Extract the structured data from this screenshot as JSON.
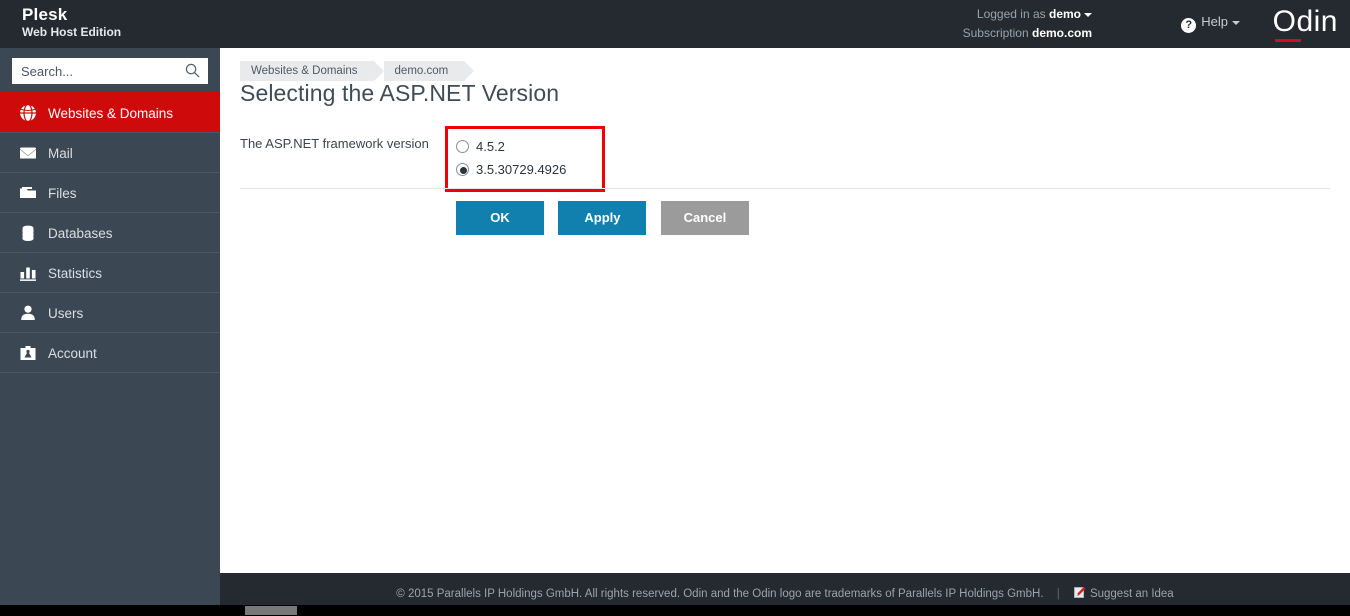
{
  "header": {
    "brand_name": "Plesk",
    "brand_sub": "Web Host Edition",
    "logged_in_label": "Logged in as",
    "logged_in_user": "demo",
    "subscription_label": "Subscription",
    "subscription_value": "demo.com",
    "help_label": "Help",
    "help_icon": "question-circle-icon",
    "logo_text": "Odin",
    "accent_red": "#cf0a2c",
    "bg": "#242a30"
  },
  "sidebar": {
    "search": {
      "placeholder": "Search...",
      "value": "",
      "icon": "search-icon"
    },
    "active_index": 0,
    "active_color": "#cf0a0a",
    "bg": "#3b4854",
    "items": [
      {
        "label": "Websites & Domains",
        "icon": "globe-icon"
      },
      {
        "label": "Mail",
        "icon": "envelope-icon"
      },
      {
        "label": "Files",
        "icon": "folder-icon"
      },
      {
        "label": "Databases",
        "icon": "database-icon"
      },
      {
        "label": "Statistics",
        "icon": "bar-chart-icon"
      },
      {
        "label": "Users",
        "icon": "user-icon"
      },
      {
        "label": "Account",
        "icon": "briefcase-icon"
      }
    ]
  },
  "main": {
    "breadcrumb": [
      {
        "label": "Websites & Domains"
      },
      {
        "label": "demo.com"
      }
    ],
    "title": "Selecting the ASP.NET Version",
    "form": {
      "label": "The ASP.NET framework version",
      "highlight_color": "#f10000",
      "options": [
        {
          "label": "4.5.2",
          "selected": false
        },
        {
          "label": "3.5.30729.4926",
          "selected": true
        }
      ]
    },
    "buttons": [
      {
        "label": "OK",
        "style": "primary"
      },
      {
        "label": "Apply",
        "style": "primary"
      },
      {
        "label": "Cancel",
        "style": "neutral"
      }
    ],
    "button_blue": "#1180ae",
    "button_gray": "#9b9b9b"
  },
  "footer": {
    "copyright": "© 2015 Parallels IP Holdings GmbH. All rights reserved. Odin and the Odin logo are trademarks of Parallels IP Holdings GmbH.",
    "separator": "|",
    "suggest_label": "Suggest an Idea",
    "suggest_icon": "note-pencil-icon"
  }
}
